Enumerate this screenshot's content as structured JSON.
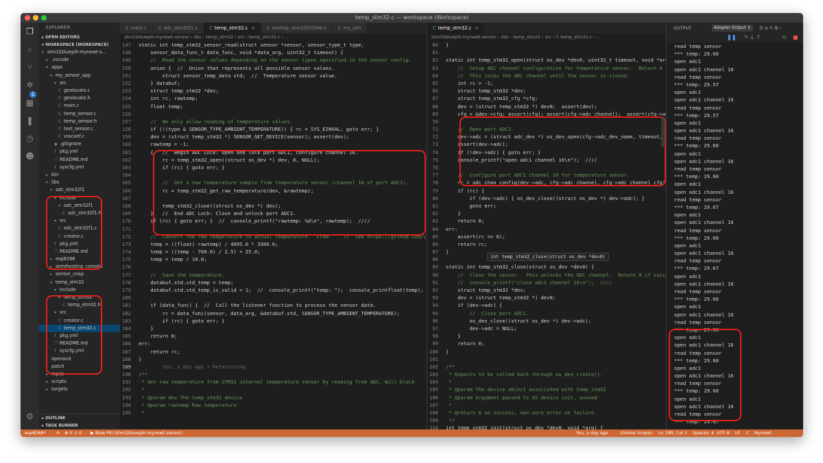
{
  "window": {
    "title": "temp_stm32.c — workspace (Workspace)"
  },
  "sidebar": {
    "title": "EXPLORER",
    "sections": [
      "OPEN EDITORS",
      "WORKSPACE (WORKSPACE)"
    ],
    "tree": [
      {
        "label": "stm32bluepill-mynewt-s...",
        "depth": 0,
        "icon": "▾"
      },
      {
        "label": ".vscode",
        "depth": 1,
        "icon": "▸"
      },
      {
        "label": "apps",
        "depth": 1,
        "icon": "▾"
      },
      {
        "label": "my_sensor_app",
        "depth": 2,
        "icon": "▾"
      },
      {
        "label": "src",
        "depth": 3,
        "icon": "▾"
      },
      {
        "label": "geolocate.c",
        "depth": 4,
        "icon": "C"
      },
      {
        "label": "geolocate.h",
        "depth": 4,
        "icon": "C"
      },
      {
        "label": "main.c",
        "depth": 4,
        "icon": "C"
      },
      {
        "label": "temp_sensor.c",
        "depth": 4,
        "icon": "C"
      },
      {
        "label": "temp_sensor.h",
        "depth": 4,
        "icon": "C"
      },
      {
        "label": "test_sensor.c",
        "depth": 4,
        "icon": "C"
      },
      {
        "label": "vsscanf.c",
        "depth": 4,
        "icon": "C"
      },
      {
        "label": ".gitignore",
        "depth": 3,
        "icon": "◆"
      },
      {
        "label": "pkg.yml",
        "depth": 3,
        "icon": "!"
      },
      {
        "label": "README.md",
        "depth": 3,
        "icon": "ⓘ"
      },
      {
        "label": "syscfg.yml",
        "depth": 3,
        "icon": "!"
      },
      {
        "label": "bin",
        "depth": 1,
        "icon": "▸"
      },
      {
        "label": "libs",
        "depth": 1,
        "icon": "▾"
      },
      {
        "label": "adc_stm32f1",
        "depth": 2,
        "icon": "▾"
      },
      {
        "label": "include",
        "depth": 3,
        "icon": "▾"
      },
      {
        "label": "adc_stm32f1",
        "depth": 4,
        "icon": "▾"
      },
      {
        "label": "adc_stm32f1.h",
        "depth": 5,
        "icon": "C"
      },
      {
        "label": "src",
        "depth": 3,
        "icon": "▾"
      },
      {
        "label": "adc_stm32f1.c",
        "depth": 4,
        "icon": "C"
      },
      {
        "label": "creator.c",
        "depth": 4,
        "icon": "C"
      },
      {
        "label": "pkg.yml",
        "depth": 3,
        "icon": "!"
      },
      {
        "label": "README.md",
        "depth": 3,
        "icon": "ⓘ"
      },
      {
        "label": "esp8266",
        "depth": 2,
        "icon": "▸"
      },
      {
        "label": "semihosting_console",
        "depth": 2,
        "icon": "▸"
      },
      {
        "label": "sensor_coap",
        "depth": 2,
        "icon": "▸"
      },
      {
        "label": "temp_stm32",
        "depth": 2,
        "icon": "▾"
      },
      {
        "label": "include",
        "depth": 3,
        "icon": "▾"
      },
      {
        "label": "temp_stm32",
        "depth": 4,
        "icon": "▾"
      },
      {
        "label": "temp_stm32.h",
        "depth": 5,
        "icon": "C"
      },
      {
        "label": "src",
        "depth": 3,
        "icon": "▾"
      },
      {
        "label": "creator.c",
        "depth": 4,
        "icon": "C"
      },
      {
        "label": "temp_stm32.c",
        "depth": 4,
        "icon": "C",
        "selected": true
      },
      {
        "label": "pkg.yml",
        "depth": 3,
        "icon": "!"
      },
      {
        "label": "README.md",
        "depth": 3,
        "icon": "ⓘ"
      },
      {
        "label": "syscfg.yml",
        "depth": 3,
        "icon": "!"
      },
      {
        "label": "openocd",
        "depth": 1,
        "icon": "▸"
      },
      {
        "label": "patch",
        "depth": 1,
        "icon": "▸"
      },
      {
        "label": "repos",
        "depth": 1,
        "icon": "▸"
      },
      {
        "label": "scripts",
        "depth": 1,
        "icon": "▸"
      },
      {
        "label": "targets",
        "depth": 1,
        "icon": "▸"
      }
    ],
    "bottom_sections": [
      "OUTLINE",
      "TASK RUNNER"
    ]
  },
  "editor1": {
    "tabs": [
      {
        "label": "main.c",
        "active": false
      },
      {
        "label": "adc_stm32f1.c",
        "active": false
      },
      {
        "label": "temp_stm32.c",
        "active": true
      },
      {
        "label": "startup_stm32f103xb.s",
        "active": false
      },
      {
        "label": "my_sen",
        "active": false
      }
    ],
    "breadcrumb": "stm32bluepill-mynewt-sensor › libs › temp_stm32 › src › temp_stm32.c › ...",
    "lines": [
      {
        "n": "147",
        "t": "static int temp_stm32_sensor_read(struct sensor *sensor, sensor_type_t type,"
      },
      {
        "n": "148",
        "t": "    sensor_data_func_t data_func, void *data_arg, uint32_t timeout) {"
      },
      {
        "n": "149",
        "t": "    //  Read the sensor values depending on the sensor types specified in the sensor config.",
        "c": "cm"
      },
      {
        "n": "150",
        "t": "    union {  //  Union that represents all possible sensor values."
      },
      {
        "n": "151",
        "t": "        struct sensor_temp_data std;  //  Temperature sensor value."
      },
      {
        "n": "152",
        "t": "    } databuf;"
      },
      {
        "n": "153",
        "t": "    struct temp_stm32 *dev;"
      },
      {
        "n": "154",
        "t": "    int rc, rawtemp;"
      },
      {
        "n": "155",
        "t": "    float temp;"
      },
      {
        "n": "156",
        "t": ""
      },
      {
        "n": "157",
        "t": "    //  We only allow reading of temperature values.",
        "c": "cm"
      },
      {
        "n": "158",
        "t": "    if (!(type & SENSOR_TYPE_AMBIENT_TEMPERATURE)) { rc = SYS_EINVAL; goto err; }"
      },
      {
        "n": "159",
        "t": "    dev = (struct temp_stm32 *) SENSOR_GET_DEVICE(sensor); assert(dev);"
      },
      {
        "n": "160",
        "t": "    rawtemp = -1;"
      },
      {
        "n": "161",
        "t": "    {   //  Begin ADC Lock: Open and lock port ADC1, configure channel 16."
      },
      {
        "n": "162",
        "t": "        rc = temp_stm32_open((struct os_dev *) dev, 0, NULL);"
      },
      {
        "n": "163",
        "t": "        if (rc) { goto err; }"
      },
      {
        "n": "164",
        "t": ""
      },
      {
        "n": "165",
        "t": "        //  Get a new temperature sample from temperature sensor (channel 16 of port ADC1).",
        "c": "cm"
      },
      {
        "n": "166",
        "t": "        rc = temp_stm32_get_raw_temperature(dev, &rawtemp);"
      },
      {
        "n": "167",
        "t": ""
      },
      {
        "n": "168",
        "t": "        temp_stm32_close((struct os_dev *) dev);"
      },
      {
        "n": "169",
        "t": "    }   //  End ADC Lock: Close and unlock port ADC1."
      },
      {
        "n": "170",
        "t": "    if (rc) { goto err; }  //  console_printf(\"rawtemp: %d\\n\", rawtemp);  ////"
      },
      {
        "n": "171",
        "t": ""
      },
      {
        "n": "172",
        "t": "    //  Convert the raw temperature to actual temperature.  From     //  See https://github.com/cnoviello",
        "c": "cm"
      },
      {
        "n": "173",
        "t": "    temp = ((float) rawtemp) / 4095.0 * 3300.0;"
      },
      {
        "n": "174",
        "t": "    temp = ((temp - 760.0) / 2.5) + 25.0;"
      },
      {
        "n": "175",
        "t": "    temp = temp / 10.0;"
      },
      {
        "n": "176",
        "t": ""
      },
      {
        "n": "177",
        "t": "    //  Save the temperature.",
        "c": "cm"
      },
      {
        "n": "178",
        "t": "    databuf.std.std_temp = temp;"
      },
      {
        "n": "179",
        "t": "    databuf.std.std_temp_is_valid = 1;  //  console_printf(\"temp: \");  console_printfloat(temp);"
      },
      {
        "n": "180",
        "t": ""
      },
      {
        "n": "181",
        "t": "    if (data_func) {  //  Call the listener function to process the sensor data."
      },
      {
        "n": "182",
        "t": "        rc = data_func(sensor, data_arg, &databuf.std, SENSOR_TYPE_AMBIENT_TEMPERATURE);"
      },
      {
        "n": "183",
        "t": "        if (rc) { goto err; }"
      },
      {
        "n": "184",
        "t": "    }"
      },
      {
        "n": "185",
        "t": "    return 0;"
      },
      {
        "n": "186",
        "t": "err:"
      },
      {
        "n": "187",
        "t": "    return rc;"
      },
      {
        "n": "188",
        "t": "}"
      },
      {
        "n": "189",
        "t": "        You, a day ago • Refactoring",
        "c": "dim",
        "cur": true
      },
      {
        "n": "190",
        "t": "/**",
        "c": "cm"
      },
      {
        "n": "191",
        "t": " * Get raw temperature from STM32 internal temperature sensor by reading from ADC. Will block",
        "c": "cm"
      },
      {
        "n": "192",
        "t": " *",
        "c": "cm"
      },
      {
        "n": "193",
        "t": " * @param dev The temp_stm32 device",
        "c": "cm"
      },
      {
        "n": "194",
        "t": " * @param rawtemp Raw temperature",
        "c": "cm"
      },
      {
        "n": "195",
        "t": " *",
        "c": "cm"
      }
    ]
  },
  "editor2": {
    "tabs": [
      {
        "label": "temp_stm32.c",
        "active": true
      }
    ],
    "breadcrumb": "stm32bluepill-mynewt-sensor › libs › temp_stm32 › src › C temp_stm32.c › ...",
    "lines": [
      {
        "n": "60",
        "t": "}"
      },
      {
        "n": "61",
        "t": ""
      },
      {
        "n": "62",
        "t": "static int temp_stm32_open(struct os_dev *dev0, uint32_t timeout, void *args) {"
      },
      {
        "n": "63",
        "t": "    //  Setup ADC channel configuration for temperature sensor.  Return 0 if successful.",
        "c": "cm"
      },
      {
        "n": "64",
        "t": "    //  This locks the ADC channel until the sensor is closed.",
        "c": "cm"
      },
      {
        "n": "65",
        "t": "    int rc = -1;"
      },
      {
        "n": "66",
        "t": "    struct temp_stm32 *dev;"
      },
      {
        "n": "67",
        "t": "    struct temp_stm32_cfg *cfg;"
      },
      {
        "n": "68",
        "t": "    dev = (struct temp_stm32 *) dev0;  assert(dev);"
      },
      {
        "n": "69",
        "t": "    cfg = &dev->cfg; assert(cfg); assert(cfg->adc_channel);  assert(cfg->adc_open_arg);"
      },
      {
        "n": "70",
        "t": ""
      },
      {
        "n": "71",
        "t": "    //  Open port ADC1.",
        "c": "cm"
      },
      {
        "n": "72",
        "t": "    dev->adc = (struct adc_dev *) os_dev_open(cfg->adc_dev_name, timeout, cfg->adc_open_arg);"
      },
      {
        "n": "73",
        "t": "    assert(dev->adc);"
      },
      {
        "n": "74",
        "t": "    if (!dev->adc) { goto err; }"
      },
      {
        "n": "75",
        "t": "    console_printf(\"open adc1 channel 16\\n\");  ////"
      },
      {
        "n": "76",
        "t": ""
      },
      {
        "n": "77",
        "t": "    //  Configure port ADC1 channel 16 for temperature sensor.",
        "c": "cm"
      },
      {
        "n": "78",
        "t": "    rc = adc_chan_config(dev->adc, cfg->adc_channel, cfg->adc_channel_cfg);"
      },
      {
        "n": "79",
        "t": "    if (rc) {"
      },
      {
        "n": "80",
        "t": "        if (dev->adc) { os_dev_close((struct os_dev *) dev->adc); }"
      },
      {
        "n": "81",
        "t": "        goto err;"
      },
      {
        "n": "82",
        "t": "    }"
      },
      {
        "n": "83",
        "t": "    return 0;"
      },
      {
        "n": "84",
        "t": "err:"
      },
      {
        "n": "85",
        "t": "    assert(rc == 0);"
      },
      {
        "n": "86",
        "t": "    return rc;"
      },
      {
        "n": "87",
        "t": "}"
      },
      {
        "n": "88",
        "t": ""
      },
      {
        "n": "89",
        "t": "static int temp_stm32_close(struct os_dev *dev0) {"
      },
      {
        "n": "90",
        "t": "    //  Close the sensor.  This unlocks the ADC channel.  Return 0 if successful.",
        "c": "cm"
      },
      {
        "n": "91",
        "t": "    //  console_printf(\"close adc1 channel 16\\n\");  ////",
        "c": "cm"
      },
      {
        "n": "92",
        "t": "    struct temp_stm32 *dev;"
      },
      {
        "n": "93",
        "t": "    dev = (struct temp_stm32 *) dev0;"
      },
      {
        "n": "94",
        "t": "    if (dev->adc) {"
      },
      {
        "n": "95",
        "t": "        //  Close port ADC1.",
        "c": "cm"
      },
      {
        "n": "96",
        "t": "        os_dev_close((struct os_dev *) dev->adc);"
      },
      {
        "n": "97",
        "t": "        dev->adc = NULL;"
      },
      {
        "n": "98",
        "t": "    }"
      },
      {
        "n": "99",
        "t": "    return 0;"
      },
      {
        "n": "100",
        "t": "}"
      },
      {
        "n": "101",
        "t": ""
      },
      {
        "n": "102",
        "t": "/**",
        "c": "cm"
      },
      {
        "n": "103",
        "t": " * Expects to be called back through os_dev_create().",
        "c": "cm"
      },
      {
        "n": "104",
        "t": " *",
        "c": "cm"
      },
      {
        "n": "105",
        "t": " * @param The device object associated with temp_stm32",
        "c": "cm"
      },
      {
        "n": "106",
        "t": " * @param Argument passed to OS device init, unused",
        "c": "cm"
      },
      {
        "n": "107",
        "t": " *",
        "c": "cm"
      },
      {
        "n": "108",
        "t": " * @return 0 on success, non-zero error on failure.",
        "c": "cm"
      },
      {
        "n": "109",
        "t": " */",
        "c": "cm"
      },
      {
        "n": "110",
        "t": "int temp_stm32_init(struct os_dev *dev0, void *arg) {"
      }
    ],
    "hover": "int temp_stm32_close(struct os_dev *dev0)"
  },
  "output": {
    "title": "OUTPUT",
    "channel": "Adapter Output",
    "lines": [
      "read temp sensor",
      "*** temp: 29.60",
      "open adc1",
      "open adc1 channel 16",
      "read temp sensor",
      "*** temp: 29.57",
      "open adc1",
      "open adc1 channel 16",
      "read temp sensor",
      "*** temp: 29.57",
      "open adc1",
      "open adc1 channel 16",
      "read temp sensor",
      "*** temp: 29.60",
      "open adc1",
      "open adc1 channel 16",
      "read temp sensor",
      "*** temp: 29.60",
      "open adc1",
      "open adc1 channel 16",
      "read temp sensor",
      "*** temp: 29.67",
      "open adc1",
      "open adc1 channel 16",
      "read temp sensor",
      "*** temp: 29.60",
      "open adc1",
      "open adc1 channel 16",
      "read temp sensor",
      "*** temp: 29.67",
      "open adc1",
      "open adc1 channel 16",
      "read temp sensor",
      "*** temp: 29.60",
      "open adc1",
      "open adc1 channel 16",
      "read temp sensor",
      "*** temp: 29.60",
      "open adc1",
      "open adc1 channel 16",
      "read temp sensor",
      "*** temp: 29.60",
      "open adc1",
      "open adc1 channel 16",
      "read temp sensor",
      "*** temp: 29.60",
      "open adc1",
      "open adc1 channel 16",
      "read temp sensor",
      "*** temp: 29.67"
    ]
  },
  "statusbar": {
    "branch": "esp8266*",
    "sync": "⟳",
    "problems": "⊗ 0 ⚠ 0",
    "debug": "▶ Blue Pill (stm32bluepill-mynewt-sensor)",
    "blame": "You, a day ago",
    "scope": "(Global Scope)",
    "position": "Ln 189, Col 1",
    "spaces": "Spaces: 4",
    "encoding": "UTF-8",
    "eol": "LF",
    "lang": "C",
    "project": "Mynewt"
  },
  "colors": {
    "statusbar": "#cc6633",
    "annotation": "#e22218",
    "selection": "#094771"
  }
}
